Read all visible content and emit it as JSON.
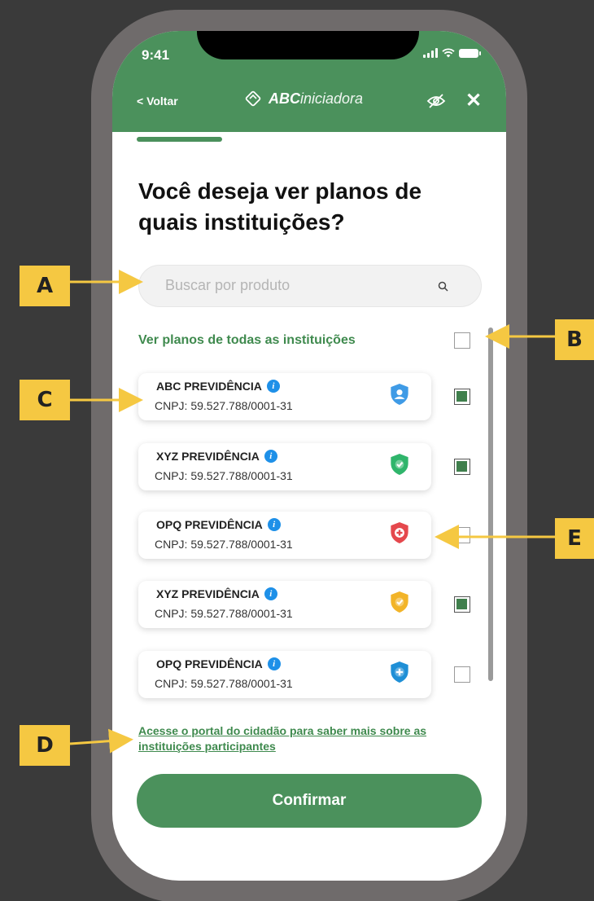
{
  "status": {
    "time": "9:41"
  },
  "header": {
    "back_label": "< Voltar",
    "brand_bold": "ABC",
    "brand_rest": "iniciadora",
    "close_label": "✕"
  },
  "page": {
    "title": "Você deseja ver planos de quais instituições?"
  },
  "search": {
    "placeholder": "Buscar por produto"
  },
  "select_all": {
    "label": "Ver planos de todas as instituições",
    "checked": false
  },
  "institutions": [
    {
      "name": "ABC PREVIDÊNCIA",
      "cnpj": "CNPJ: 59.527.788/0001-31",
      "icon": "person-shield-icon",
      "color": "#3f9be6",
      "checked": true
    },
    {
      "name": "XYZ PREVIDÊNCIA",
      "cnpj": "CNPJ: 59.527.788/0001-31",
      "icon": "check-shield-icon",
      "color": "#2fb56b",
      "checked": true
    },
    {
      "name": "OPQ PREVIDÊNCIA",
      "cnpj": "CNPJ: 59.527.788/0001-31",
      "icon": "cross-shield-icon",
      "color": "#e5484d",
      "checked": false
    },
    {
      "name": "XYZ PREVIDÊNCIA",
      "cnpj": "CNPJ: 59.527.788/0001-31",
      "icon": "check-shield-icon",
      "color": "#f2b428",
      "checked": true
    },
    {
      "name": "OPQ PREVIDÊNCIA",
      "cnpj": "CNPJ: 59.527.788/0001-31",
      "icon": "plus-shield-icon",
      "color": "#1f8fd6",
      "checked": false
    }
  ],
  "footer": {
    "portal_link": "Acesse o portal do cidadão para saber mais sobre as instituições participantes",
    "confirm_label": "Confirmar"
  },
  "callouts": {
    "a": "A",
    "b": "B",
    "c": "C",
    "d": "D",
    "e": "E"
  },
  "colors": {
    "brand_green": "#4b915c",
    "link_green": "#3f8a4e",
    "callout_yellow": "#f5c842",
    "frame_gray": "#6f6b6b",
    "background": "#3a3a3a"
  }
}
